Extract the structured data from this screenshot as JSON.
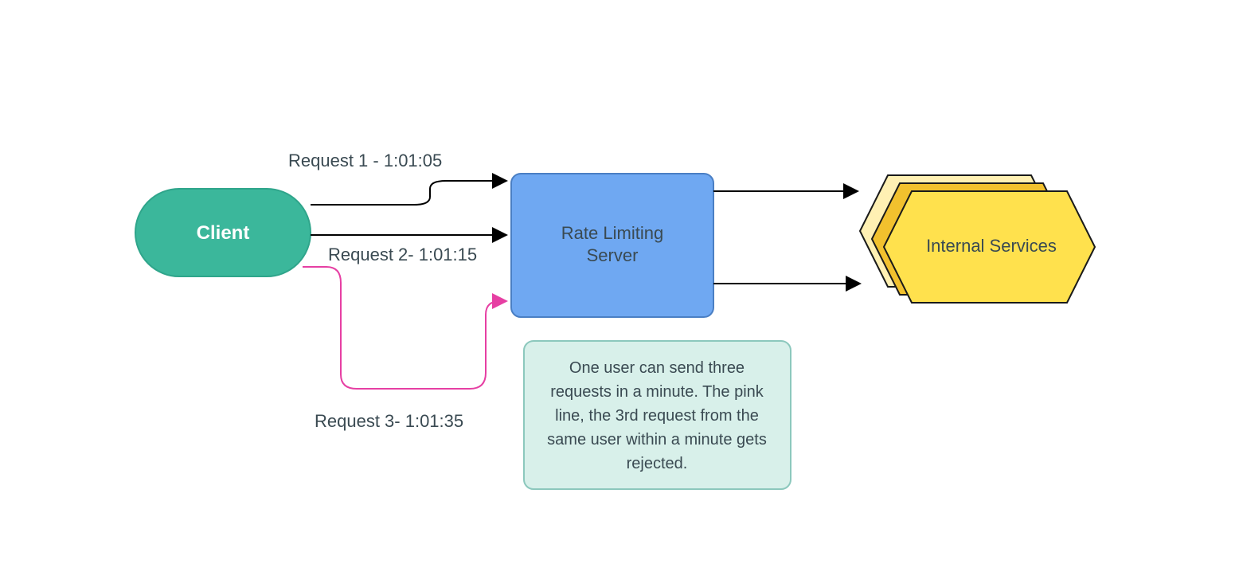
{
  "colors": {
    "client_fill": "#3bb79b",
    "client_stroke": "#2fa58b",
    "server_fill": "#6fa8f2",
    "server_stroke": "#4a7fc4",
    "hex_back_fill": "#fff0b3",
    "hex_mid_fill": "#f2c12e",
    "hex_front_fill": "#ffe14d",
    "hex_stroke": "#1a1a1a",
    "note_fill": "#d8f0ea",
    "note_stroke": "#8cc8bd",
    "edge_black": "#000000",
    "edge_pink": "#e63fa3"
  },
  "nodes": {
    "client": {
      "label": "Client"
    },
    "server": {
      "line1": "Rate Limiting",
      "line2": "Server"
    },
    "services": {
      "label": "Internal Services"
    }
  },
  "edges": {
    "req1_label": "Request 1 - 1:01:05",
    "req2_label": "Request 2- 1:01:15",
    "req3_label": "Request 3- 1:01:35"
  },
  "note": {
    "line1": "One user can send three",
    "line2": "requests in a minute. The pink",
    "line3": "line, the 3rd request from the",
    "line4": "same user within a minute gets",
    "line5": "rejected."
  }
}
